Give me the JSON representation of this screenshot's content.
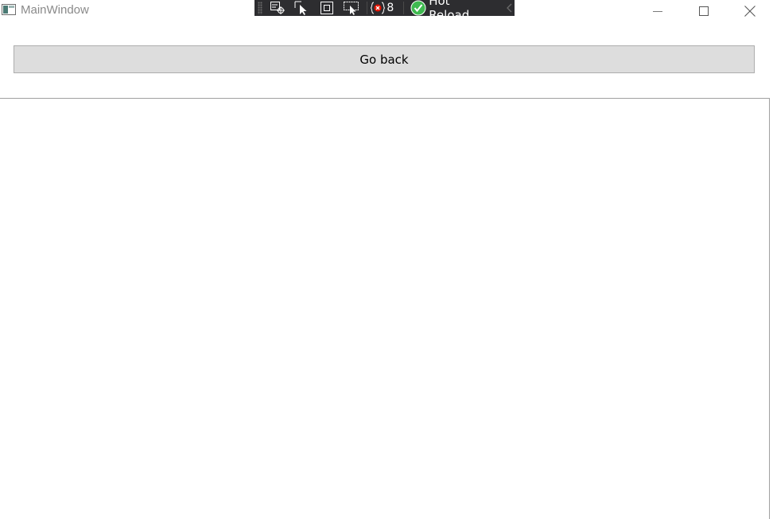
{
  "window": {
    "title": "MainWindow",
    "caption_buttons": [
      "minimize",
      "maximize",
      "close"
    ]
  },
  "devbar": {
    "icons": [
      "select-element-icon",
      "select-pointer-icon",
      "layout-adorner-icon",
      "track-focus-icon",
      "binding-errors-icon"
    ],
    "error_count": "8",
    "hot_reload_label": "Hot Reload"
  },
  "main": {
    "go_back_label": "Go back"
  },
  "colors": {
    "devbar_bg": "#2d2d30",
    "button_bg": "#dddddd",
    "button_border": "#adadad",
    "hot_reload_check": "#3fb950",
    "error_icon": "#e51400"
  }
}
